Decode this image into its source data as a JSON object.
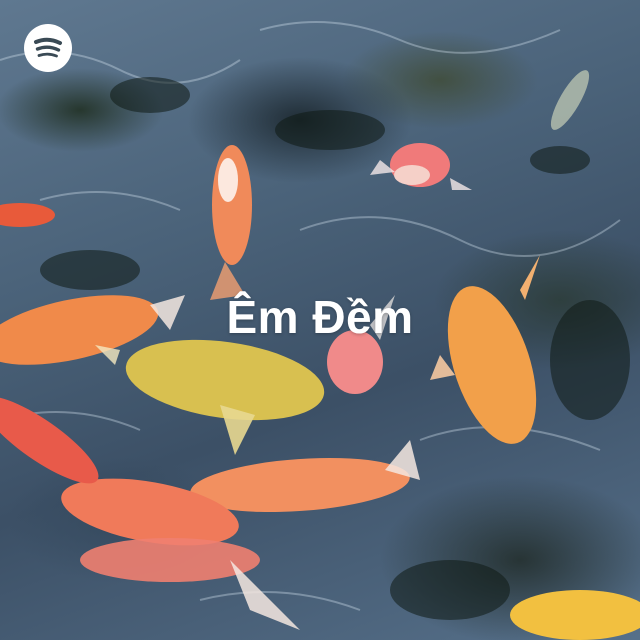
{
  "cover": {
    "title": "Êm Đềm",
    "logo_icon": "spotify-icon",
    "colors": {
      "title": "#ffffff",
      "logo_background": "#ffffff",
      "logo_mark": "#3a4a55",
      "water": "#4a6279",
      "koi_orange": "#f08a4a",
      "koi_gold": "#d8c050"
    }
  }
}
